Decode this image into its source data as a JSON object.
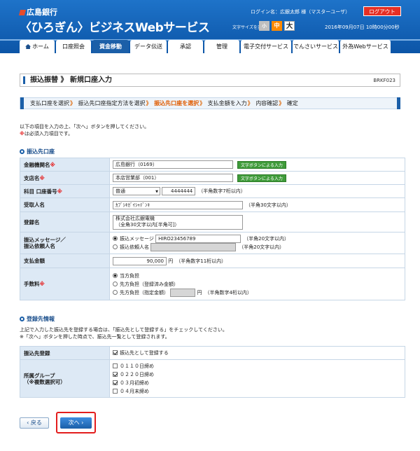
{
  "header": {
    "bank_name": "広島銀行",
    "service_name": "〈ひろぎん〉ビジネスWebサービス",
    "login_info": "ログイン名：広銀太郎 様（マスターユーザ）",
    "logout_label": "ログアウト",
    "font_size_label": "文字サイズを変更",
    "font_sizes": [
      "小",
      "中",
      "大"
    ],
    "datetime": "2016年09月07日 10時00分00秒"
  },
  "nav": {
    "tabs": [
      "ホーム",
      "口座照会",
      "資金移動",
      "データ伝送",
      "承認",
      "管理",
      "電子交付サービス",
      "でんさいサービス",
      "外為Webサービス"
    ],
    "active": "資金移動"
  },
  "page": {
    "title": "振込振替 》 新規口座入力",
    "screen_id": "BRKF023"
  },
  "steps": [
    "支払口座を選択",
    "振込先口座指定方法を選択",
    "振込先口座を選択",
    "支払金額を入力",
    "内容確認",
    "確定"
  ],
  "steps_current": "振込先口座を選択",
  "steps_sep": "》",
  "intro": {
    "line1": "以下の項目を入力の上、「次へ」ボタンを押してください。",
    "line2_mark": "※",
    "line2": "は必須入力項目です。"
  },
  "section1": {
    "heading": "振込先口座",
    "rows": {
      "bank": {
        "label": "金融機関名",
        "req": "※",
        "value": "広島銀行（0169）",
        "button": "文字ボタンによる入力"
      },
      "branch": {
        "label": "支店名",
        "req": "※",
        "value": "本店営業部（001）",
        "button": "文字ボタンによる入力"
      },
      "account": {
        "label": "科目 口座番号",
        "req": "※",
        "type_value": "普通",
        "number_value": "4444444",
        "hint": "（半角数字7桁以内）"
      },
      "recipient": {
        "label": "受取人名",
        "value": "ｶﾌﾞｼｷｶﾞｲｼｬﾃﾞﾝｷ",
        "hint": "（半角30文字以内）"
      },
      "reg_name": {
        "label": "登録名",
        "value_line1": "株式会社広銀電機",
        "value_line2": "（全角30文字以内[半角可]）"
      },
      "message": {
        "label_line1": "振込メッセージ／",
        "label_line2": "振込依頼人名",
        "opt1_label": "振込メッセージ",
        "opt1_value": "HIRO23456789",
        "opt1_hint": "（半角20文字以内）",
        "opt2_label": "振込依頼人名",
        "opt2_hint": "（半角20文字以内）"
      },
      "amount": {
        "label": "支払金額",
        "value": "90,000",
        "unit": "円",
        "hint": "（半角数字11桁以内）"
      },
      "fee": {
        "label": "手数料",
        "req": "※",
        "options": [
          "当方負担",
          "先方負担（登録済み金額）",
          "先方負担（指定金額）"
        ],
        "selected": "当方負担",
        "unit": "円",
        "hint": "（半角数字4桁以内）"
      }
    }
  },
  "section2": {
    "heading": "登録先情報",
    "text1": "上記で入力した振込先を登録する場合は、「振込先として登録する」をチェックしてください。",
    "text2": "※「次へ」ボタンを押した時点で、振込先一覧として登録されます。",
    "rows": {
      "register": {
        "label": "振込先登録",
        "option": "振込先として登録する",
        "checked": true
      },
      "group": {
        "label_line1": "所属グループ",
        "label_line2": "（※複数選択可）",
        "options": [
          "０１１０日締め",
          "０２２０日締め",
          "０３月初締め",
          "０４月末締め"
        ],
        "checked": [
          false,
          true,
          true,
          false
        ]
      }
    }
  },
  "buttons": {
    "back": "戻る",
    "next": "次へ"
  }
}
